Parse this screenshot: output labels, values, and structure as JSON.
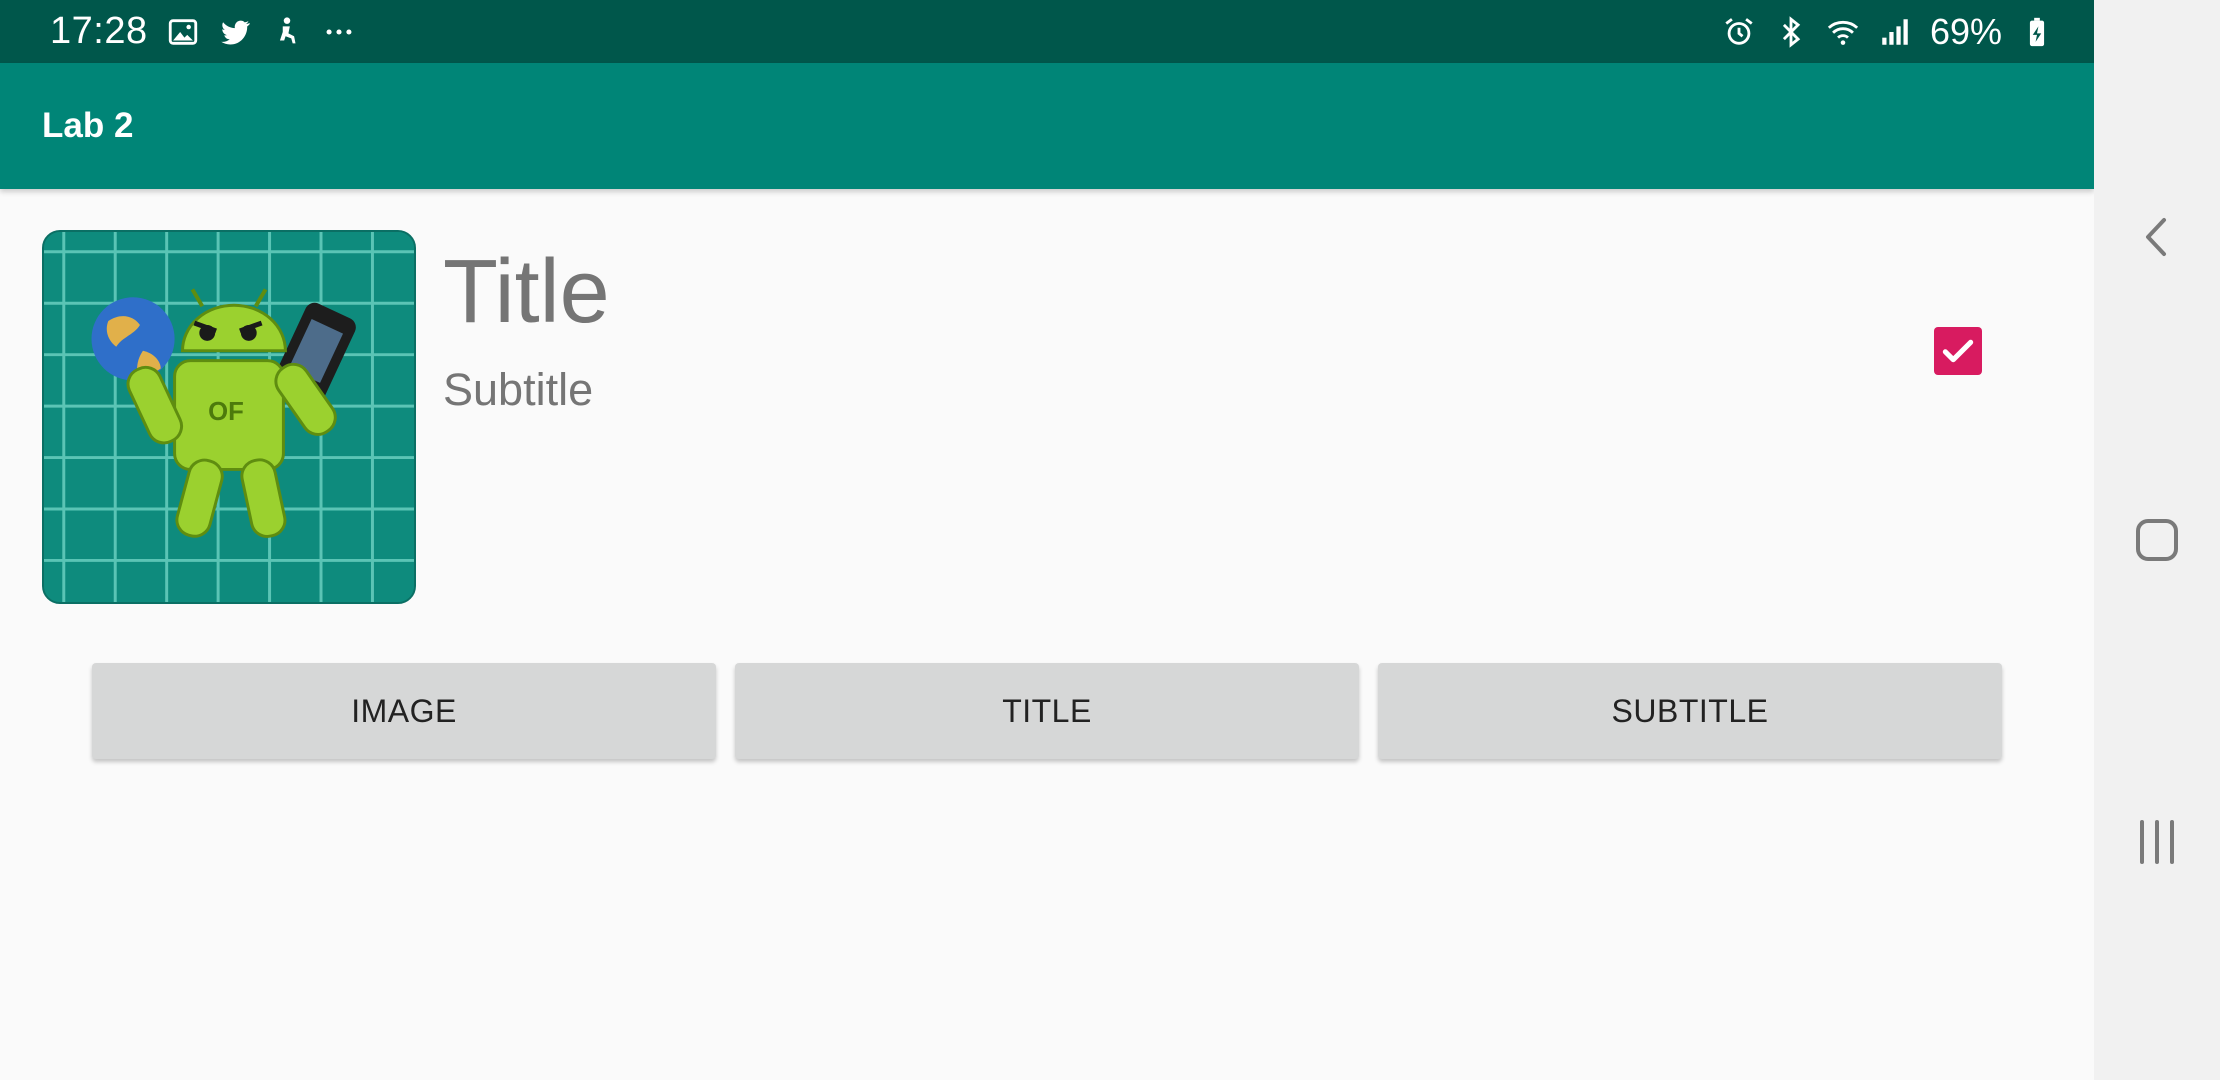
{
  "status_bar": {
    "time": "17:28",
    "notification_icons": [
      "gallery-icon",
      "twitter-icon",
      "accessibility-icon",
      "more-dots-icon"
    ],
    "system_icons": [
      "alarm-icon",
      "bluetooth-icon",
      "wifi-icon",
      "signal-icon"
    ],
    "battery": "69%"
  },
  "app_bar": {
    "title": "Lab 2"
  },
  "main": {
    "image": {
      "icon": "android-robot-logo"
    },
    "title": "Title",
    "subtitle": "Subtitle",
    "checkbox": {
      "checked": true
    }
  },
  "buttons": {
    "image_label": "IMAGE",
    "title_label": "TITLE",
    "subtitle_label": "SUBTITLE"
  },
  "nav_bar": {
    "icons": [
      "back-icon",
      "home-icon",
      "recents-icon"
    ]
  },
  "colors": {
    "status_bar": "#00574b",
    "app_bar": "#008577",
    "accent": "#d81b60",
    "background": "#fafafa",
    "button": "#d6d7d7"
  }
}
